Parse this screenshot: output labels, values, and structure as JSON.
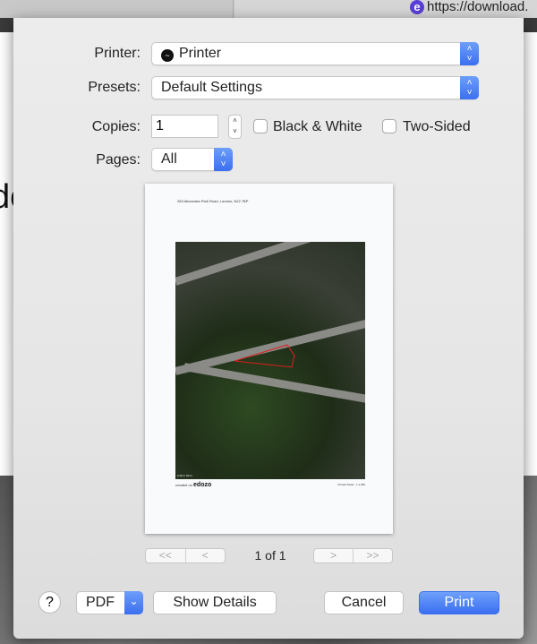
{
  "background": {
    "tab_url": "https://download.",
    "tab_icon": "e",
    "partial_text": "do"
  },
  "printer": {
    "label": "Printer:",
    "value": "Printer"
  },
  "presets": {
    "label": "Presets:",
    "value": "Default Settings"
  },
  "copies": {
    "label": "Copies:",
    "value": "1"
  },
  "black_white": {
    "label": "Black & White",
    "checked": false
  },
  "two_sided": {
    "label": "Two-Sided",
    "checked": false
  },
  "pages": {
    "label": "Pages:",
    "value": "All"
  },
  "preview": {
    "address": "283 Alexandra Park Road, London, N22 7BP",
    "created_by": "created on",
    "brand": "edozo",
    "scale_text": "Printed Scale - 1:1,250",
    "scale_bar": [
      "0",
      "25 m",
      "50 m"
    ]
  },
  "pager": {
    "first": "<<",
    "prev": "<",
    "next": ">",
    "last": ">>",
    "info": "1 of 1"
  },
  "buttons": {
    "help": "?",
    "pdf": "PDF",
    "show_details": "Show Details",
    "cancel": "Cancel",
    "print": "Print"
  },
  "colors": {
    "accent": "#3a6ff1",
    "parcel": "#e02020"
  }
}
